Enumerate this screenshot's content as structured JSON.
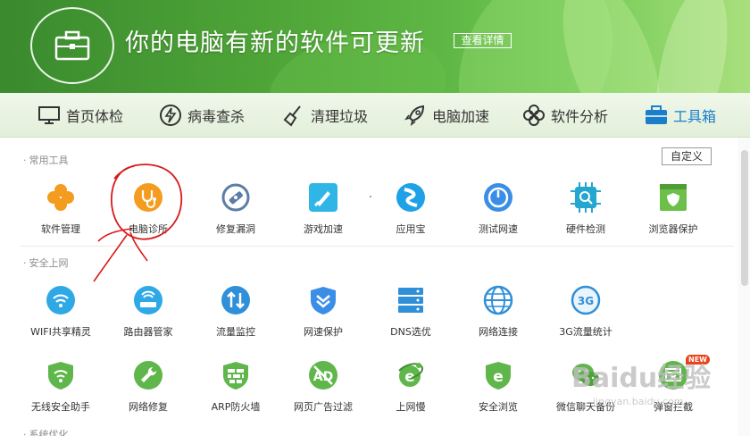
{
  "banner": {
    "title": "你的电脑有新的软件可更新",
    "details_button": "查看详情"
  },
  "nav": [
    {
      "label": "首页体检",
      "icon": "monitor-icon",
      "active": false
    },
    {
      "label": "病毒查杀",
      "icon": "lightning-icon",
      "active": false
    },
    {
      "label": "清理垃圾",
      "icon": "broom-icon",
      "active": false
    },
    {
      "label": "电脑加速",
      "icon": "rocket-icon",
      "active": false
    },
    {
      "label": "软件分析",
      "icon": "clover-icon",
      "active": false
    },
    {
      "label": "工具箱",
      "icon": "toolbox-icon",
      "active": true
    }
  ],
  "customize_button": "自定义",
  "sections": {
    "common": {
      "label": "常用工具",
      "tools": [
        {
          "label": "软件管理",
          "icon": "software-manager-icon",
          "color": "#f39c1f"
        },
        {
          "label": "电脑诊所",
          "icon": "stethoscope-icon",
          "color": "#f39c1f"
        },
        {
          "label": "修复漏洞",
          "icon": "patch-icon",
          "color": "#5c7ea6"
        },
        {
          "label": "游戏加速",
          "icon": "game-boost-icon",
          "color": "#2fb5e6"
        },
        {
          "label": "应用宝",
          "icon": "app-store-icon",
          "color": "#1ea1e6"
        },
        {
          "label": "测试网速",
          "icon": "speed-test-icon",
          "color": "#3a8ee6"
        },
        {
          "label": "硬件检测",
          "icon": "hardware-icon",
          "color": "#23a6cf"
        },
        {
          "label": "浏览器保护",
          "icon": "browser-protect-icon",
          "color": "#6cc04a"
        }
      ]
    },
    "security": {
      "label": "安全上网",
      "tools": [
        {
          "label": "WIFI共享精灵",
          "icon": "wifi-share-icon",
          "color": "#2fa8e6"
        },
        {
          "label": "路由器管家",
          "icon": "router-icon",
          "color": "#2fa8e6"
        },
        {
          "label": "流量监控",
          "icon": "traffic-icon",
          "color": "#2f8fd8"
        },
        {
          "label": "网速保护",
          "icon": "shield-speed-icon",
          "color": "#3a8ee6"
        },
        {
          "label": "DNS选优",
          "icon": "dns-icon",
          "color": "#2f8fd8"
        },
        {
          "label": "网络连接",
          "icon": "globe-icon",
          "color": "#2f8fd8"
        },
        {
          "label": "3G流量统计",
          "icon": "3g-icon",
          "color": "#2f8fd8"
        }
      ],
      "tools_row2": [
        {
          "label": "无线安全助手",
          "icon": "wifi-shield-icon",
          "color": "#5fb64a"
        },
        {
          "label": "网络修复",
          "icon": "wrench-icon",
          "color": "#5fb64a"
        },
        {
          "label": "ARP防火墙",
          "icon": "firewall-icon",
          "color": "#5fb64a"
        },
        {
          "label": "网页广告过滤",
          "icon": "ad-filter-icon",
          "color": "#5fb64a"
        },
        {
          "label": "上网慢",
          "icon": "ie-slow-icon",
          "color": "#5fb64a"
        },
        {
          "label": "安全浏览",
          "icon": "safe-browse-icon",
          "color": "#5fb64a"
        },
        {
          "label": "微信聊天备份",
          "icon": "wechat-icon",
          "color": "#5fb64a"
        },
        {
          "label": "弹窗拦截",
          "icon": "popup-block-icon",
          "color": "#5fb64a"
        }
      ]
    },
    "partial": {
      "label": "系统优化"
    }
  },
  "new_badge": "NEW",
  "watermark": {
    "main": "Baidu经验",
    "sub": "jingyan.baidu.com"
  }
}
